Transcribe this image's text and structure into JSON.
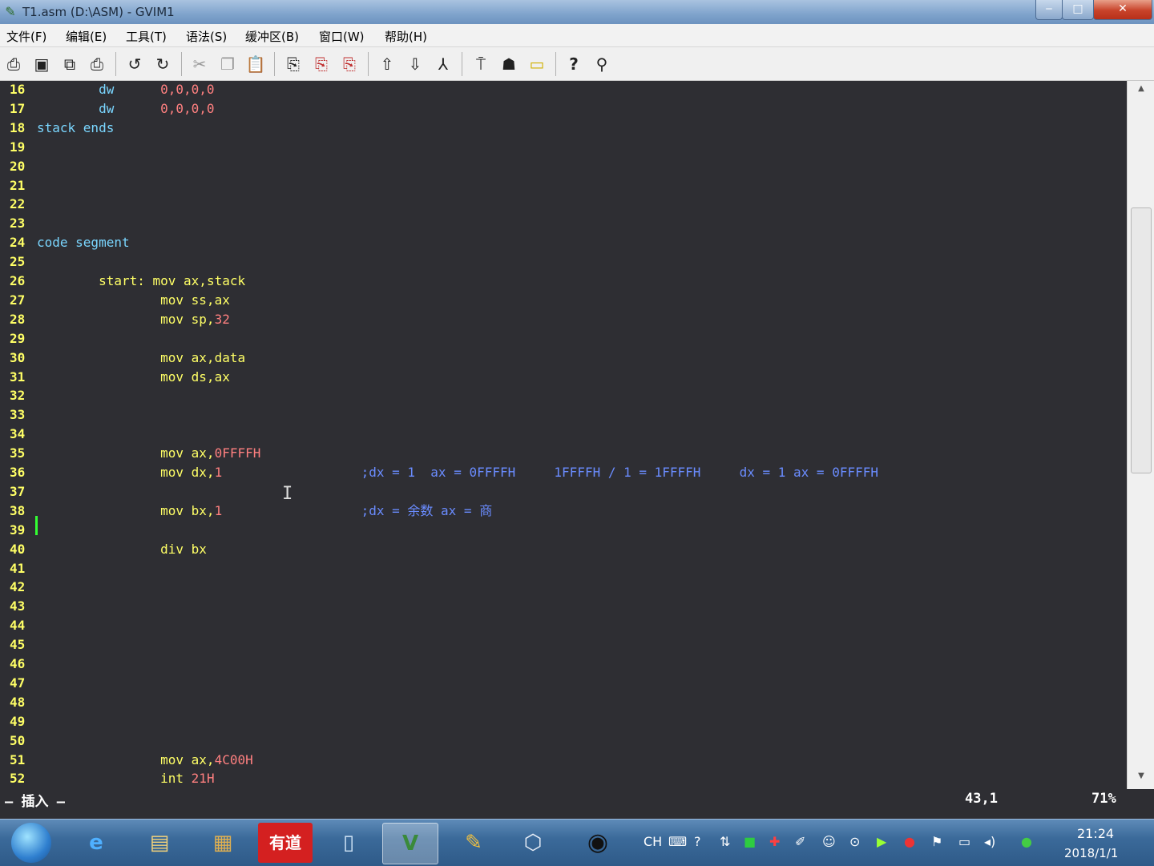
{
  "window": {
    "title": "T1.asm (D:\\ASM) - GVIM1",
    "min_label": "‒",
    "max_label": "□",
    "close_label": "✕"
  },
  "menu": [
    "文件(F)",
    "编辑(E)",
    "工具(T)",
    "语法(S)",
    "缓冲区(B)",
    "窗口(W)",
    "帮助(H)"
  ],
  "toolbar_icons": [
    "open-icon",
    "save-icon",
    "save-all-icon",
    "print-icon",
    "undo-icon",
    "redo-icon",
    "cut-icon",
    "copy-icon",
    "paste-icon",
    "find-replace-icon",
    "find-next-icon",
    "find-prev-icon",
    "load-session-icon",
    "save-session-icon",
    "run-script-icon",
    "make-icon",
    "shell-icon",
    "ctags-icon",
    "help-icon",
    "find-help-icon"
  ],
  "editor": {
    "lines": [
      {
        "n": "16",
        "code": [
          {
            "t": "        ",
            "c": ""
          },
          {
            "t": "dw",
            "c": "dir"
          },
          {
            "t": "      ",
            "c": ""
          },
          {
            "t": "0,0,0,0",
            "c": "num"
          }
        ]
      },
      {
        "n": "17",
        "code": [
          {
            "t": "        ",
            "c": ""
          },
          {
            "t": "dw",
            "c": "dir"
          },
          {
            "t": "      ",
            "c": ""
          },
          {
            "t": "0,0,0,0",
            "c": "num"
          }
        ]
      },
      {
        "n": "18",
        "code": [
          {
            "t": "stack ends",
            "c": "dir"
          }
        ]
      },
      {
        "n": "19",
        "code": []
      },
      {
        "n": "20",
        "code": []
      },
      {
        "n": "21",
        "code": []
      },
      {
        "n": "22",
        "code": []
      },
      {
        "n": "23",
        "code": []
      },
      {
        "n": "24",
        "code": [
          {
            "t": "code segment",
            "c": "dir"
          }
        ]
      },
      {
        "n": "25",
        "code": []
      },
      {
        "n": "26",
        "code": [
          {
            "t": "        ",
            "c": ""
          },
          {
            "t": "start:",
            "c": "kw"
          },
          {
            "t": " ",
            "c": ""
          },
          {
            "t": "mov",
            "c": "ins"
          },
          {
            "t": " ax,stack",
            "c": "ins"
          }
        ]
      },
      {
        "n": "27",
        "code": [
          {
            "t": "                ",
            "c": ""
          },
          {
            "t": "mov",
            "c": "ins"
          },
          {
            "t": " ss,ax",
            "c": "ins"
          }
        ]
      },
      {
        "n": "28",
        "code": [
          {
            "t": "                ",
            "c": ""
          },
          {
            "t": "mov",
            "c": "ins"
          },
          {
            "t": " sp,",
            "c": "ins"
          },
          {
            "t": "32",
            "c": "num"
          }
        ]
      },
      {
        "n": "29",
        "code": []
      },
      {
        "n": "30",
        "code": [
          {
            "t": "                ",
            "c": ""
          },
          {
            "t": "mov",
            "c": "ins"
          },
          {
            "t": " ax,data",
            "c": "ins"
          }
        ]
      },
      {
        "n": "31",
        "code": [
          {
            "t": "                ",
            "c": ""
          },
          {
            "t": "mov",
            "c": "ins"
          },
          {
            "t": " ds,ax",
            "c": "ins"
          }
        ]
      },
      {
        "n": "32",
        "code": []
      },
      {
        "n": "33",
        "code": []
      },
      {
        "n": "34",
        "code": []
      },
      {
        "n": "35",
        "code": [
          {
            "t": "                ",
            "c": ""
          },
          {
            "t": "mov",
            "c": "ins"
          },
          {
            "t": " ax,",
            "c": "ins"
          },
          {
            "t": "0FFFFH",
            "c": "num"
          }
        ]
      },
      {
        "n": "36",
        "code": [
          {
            "t": "                ",
            "c": ""
          },
          {
            "t": "mov",
            "c": "ins"
          },
          {
            "t": " dx,",
            "c": "ins"
          },
          {
            "t": "1",
            "c": "num"
          },
          {
            "t": "                  ",
            "c": ""
          },
          {
            "t": ";dx = 1  ax = 0FFFFH     1FFFFH / 1 = 1FFFFH     dx = 1 ax = 0FFFFH",
            "c": "cmt"
          }
        ]
      },
      {
        "n": "37",
        "code": []
      },
      {
        "n": "38",
        "code": [
          {
            "t": "                ",
            "c": ""
          },
          {
            "t": "mov",
            "c": "ins"
          },
          {
            "t": " bx,",
            "c": "ins"
          },
          {
            "t": "1",
            "c": "num"
          },
          {
            "t": "                  ",
            "c": ""
          },
          {
            "t": ";dx = 余数 ax = 商",
            "c": "cmt"
          }
        ]
      },
      {
        "n": "39",
        "code": []
      },
      {
        "n": "40",
        "code": [
          {
            "t": "                ",
            "c": ""
          },
          {
            "t": "div",
            "c": "ins"
          },
          {
            "t": " bx",
            "c": "ins"
          }
        ]
      },
      {
        "n": "41",
        "code": []
      },
      {
        "n": "42",
        "code": []
      },
      {
        "n": "43",
        "code": []
      },
      {
        "n": "44",
        "code": []
      },
      {
        "n": "45",
        "code": []
      },
      {
        "n": "46",
        "code": []
      },
      {
        "n": "47",
        "code": []
      },
      {
        "n": "48",
        "code": []
      },
      {
        "n": "49",
        "code": []
      },
      {
        "n": "50",
        "code": []
      },
      {
        "n": "51",
        "code": [
          {
            "t": "                ",
            "c": ""
          },
          {
            "t": "mov",
            "c": "ins"
          },
          {
            "t": " ax,",
            "c": "ins"
          },
          {
            "t": "4C00H",
            "c": "num"
          }
        ]
      },
      {
        "n": "52",
        "code": [
          {
            "t": "                ",
            "c": ""
          },
          {
            "t": "int",
            "c": "ins"
          },
          {
            "t": " ",
            "c": ""
          },
          {
            "t": "21H",
            "c": "num"
          }
        ]
      }
    ]
  },
  "status": {
    "mode": "— 插入 —",
    "position": "43,1",
    "percent": "71%"
  },
  "taskbar": {
    "apps": [
      "internet-explorer-icon",
      "file-explorer-icon",
      "archive-icon",
      "youdao-dict-icon",
      "document-icon",
      "gvim-icon",
      "paint-icon",
      "virtualbox-icon",
      "obs-icon"
    ],
    "tray_lang": "CH",
    "time": "21:24",
    "date": "2018/1/1"
  }
}
